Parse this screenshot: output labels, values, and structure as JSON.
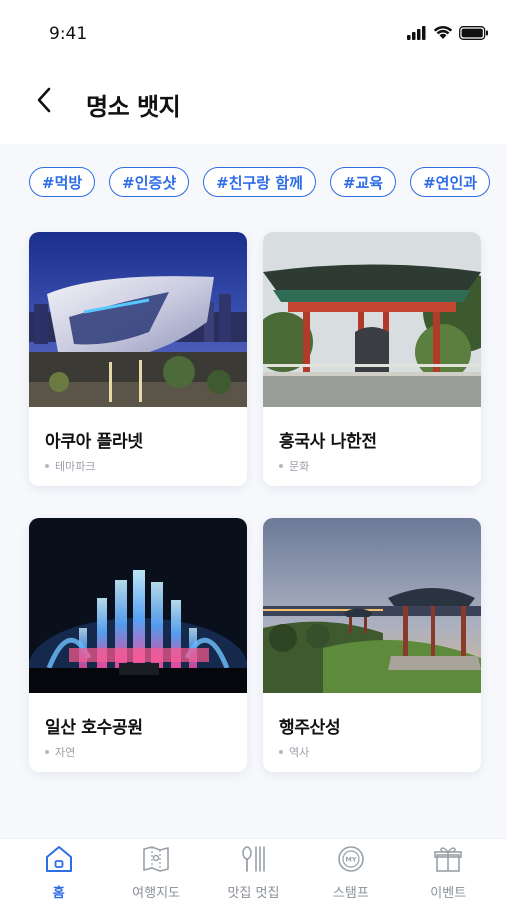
{
  "status_bar": {
    "time": "9:41",
    "icons": [
      "signal-icon",
      "wifi-icon",
      "battery-icon"
    ]
  },
  "header": {
    "back_icon": "chevron-left-icon",
    "title": "명소 뱃지"
  },
  "tags": [
    "#먹방",
    "#인증샷",
    "#친구랑 함께",
    "#교육",
    "#연인과"
  ],
  "cards": [
    {
      "name": "아쿠아 플라넷",
      "category": "테마파크"
    },
    {
      "name": "흥국사 나한전",
      "category": "문화"
    },
    {
      "name": "일산 호수공원",
      "category": "자연"
    },
    {
      "name": "행주산성",
      "category": "역사"
    }
  ],
  "nav": [
    {
      "label": "홈",
      "icon": "home-icon",
      "active": true
    },
    {
      "label": "여행지도",
      "icon": "map-icon",
      "active": false
    },
    {
      "label": "맛집 멋집",
      "icon": "utensils-icon",
      "active": false
    },
    {
      "label": "스탬프",
      "icon": "stamp-icon",
      "active": false
    },
    {
      "label": "이벤트",
      "icon": "gift-icon",
      "active": false
    }
  ],
  "colors": {
    "accent": "#2f6de5",
    "background": "#f6f8fc",
    "inactive": "#8a9099"
  }
}
